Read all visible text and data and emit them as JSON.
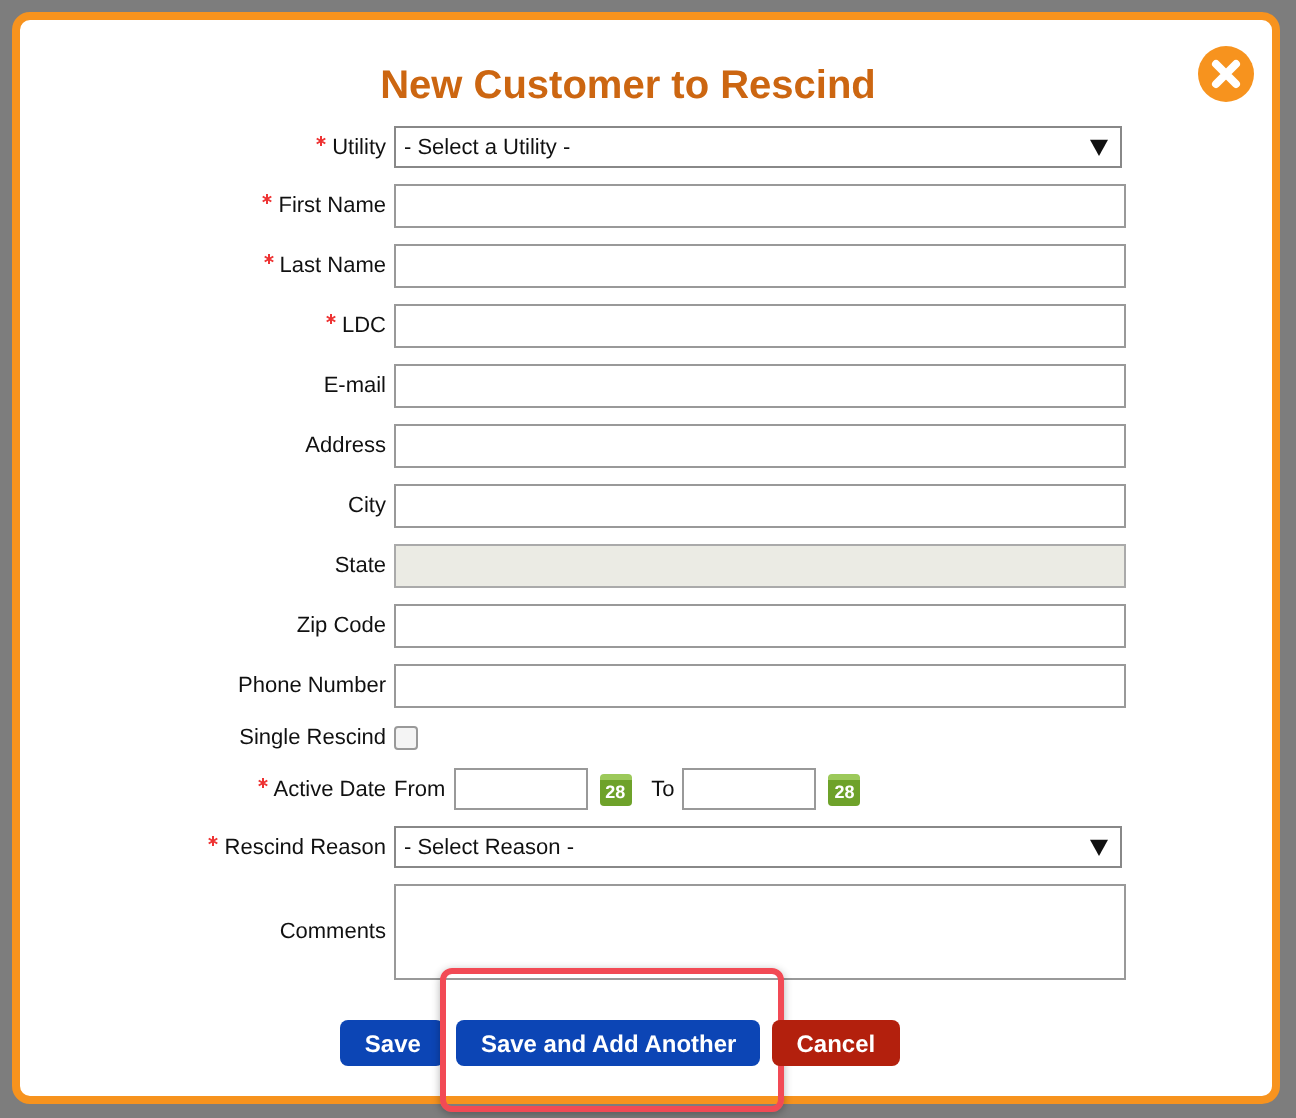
{
  "dialog": {
    "title": "New Customer to Rescind",
    "fields": [
      {
        "kind": "select",
        "label": "Utility",
        "required": true,
        "value": "- Select a Utility -"
      },
      {
        "kind": "text",
        "label": "First Name",
        "required": true,
        "disabled": false
      },
      {
        "kind": "text",
        "label": "Last Name",
        "required": true,
        "disabled": false
      },
      {
        "kind": "text",
        "label": "LDC",
        "required": true,
        "disabled": false
      },
      {
        "kind": "text",
        "label": "E-mail",
        "required": false,
        "disabled": false
      },
      {
        "kind": "text",
        "label": "Address",
        "required": false,
        "disabled": false
      },
      {
        "kind": "text",
        "label": "City",
        "required": false,
        "disabled": false
      },
      {
        "kind": "text",
        "label": "State",
        "required": false,
        "disabled": true
      },
      {
        "kind": "text",
        "label": "Zip Code",
        "required": false,
        "disabled": false
      },
      {
        "kind": "text",
        "label": "Phone Number",
        "required": false,
        "disabled": false
      },
      {
        "kind": "checkbox",
        "label": "Single Rescind",
        "required": false,
        "checked": false
      },
      {
        "kind": "daterange",
        "label": "Active Date",
        "required": true,
        "from_label": "From",
        "to_label": "To",
        "from_calendar_day": "28",
        "to_calendar_day": "28"
      },
      {
        "kind": "select",
        "label": "Rescind Reason",
        "required": true,
        "value": "- Select Reason -"
      },
      {
        "kind": "textarea",
        "label": "Comments",
        "required": false
      }
    ],
    "buttons": [
      {
        "label": "Save",
        "kind": "primary",
        "highlighted": false
      },
      {
        "label": "Save and Add Another",
        "kind": "primary",
        "highlighted": true
      },
      {
        "label": "Cancel",
        "kind": "danger",
        "highlighted": false
      }
    ]
  }
}
